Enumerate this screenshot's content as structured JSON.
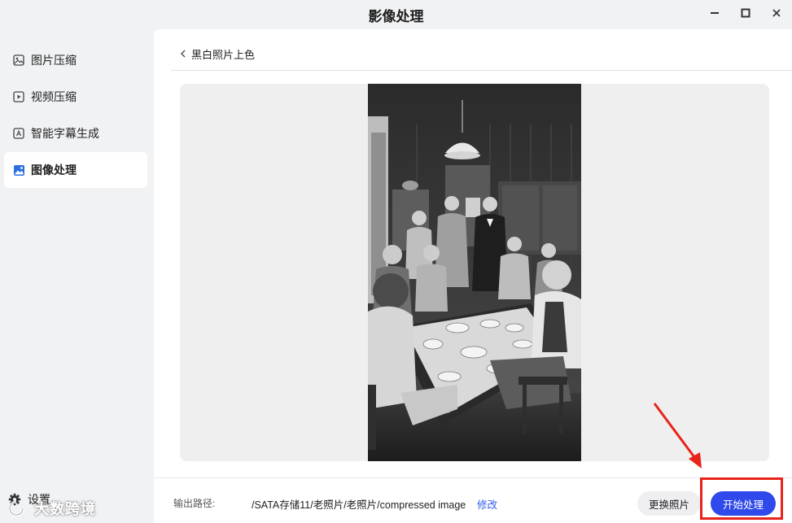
{
  "window": {
    "title": "影像处理",
    "controls": {
      "minimize_icon": "minimize-icon",
      "maximize_icon": "maximize-icon",
      "close_icon": "close-icon"
    }
  },
  "sidebar": {
    "items": [
      {
        "label": "图片压缩",
        "icon": "image-icon",
        "active": false
      },
      {
        "label": "视频压缩",
        "icon": "video-icon",
        "active": false
      },
      {
        "label": "智能字幕生成",
        "icon": "subtitle-icon",
        "active": false
      },
      {
        "label": "图像处理",
        "icon": "image-process-icon",
        "active": true
      }
    ],
    "settings_label": "设置",
    "watermark_text": "大数跨境"
  },
  "main": {
    "breadcrumb": "黑白照片上色",
    "output_label": "输出路径:",
    "output_path": "/SATA存储11/老照片/老照片/compressed image",
    "modify_label": "修改",
    "replace_button": "更换照片",
    "start_button": "开始处理"
  },
  "colors": {
    "primary": "#2f49ea",
    "link": "#2f5bea",
    "annotation": "#e8231a",
    "sidebar_bg": "#f1f2f4"
  }
}
